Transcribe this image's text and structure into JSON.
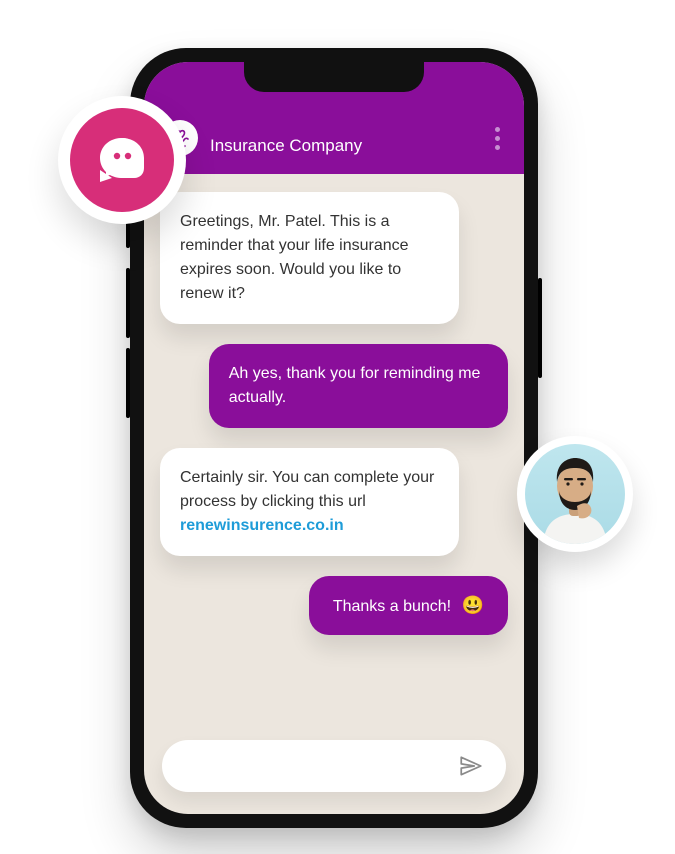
{
  "header": {
    "brand_name": "Insurance Company",
    "brand_icon": "hands-heart-icon",
    "menu_icon": "kebab-icon"
  },
  "messages": [
    {
      "role": "bot",
      "text": "Greetings, Mr. Patel. This is a reminder that your life insurance expires soon. Would you like to renew it?"
    },
    {
      "role": "user",
      "text": "Ah yes, thank you for reminding me actually."
    },
    {
      "role": "bot",
      "text": "Certainly sir. You can complete your process by clicking this url ",
      "link_text": "renewinsurence.co.in"
    },
    {
      "role": "user",
      "text": "Thanks a bunch!  ",
      "emoji": "😃"
    }
  ],
  "input": {
    "placeholder": "",
    "send_icon": "send-icon"
  },
  "decor": {
    "chat_badge_icon": "chat-bubble-icon",
    "user_avatar_alt": "user-avatar"
  },
  "colors": {
    "accent": "#8a0e9a",
    "badge": "#d72e79",
    "link": "#1e9cd8",
    "canvas": "#ece6de"
  }
}
